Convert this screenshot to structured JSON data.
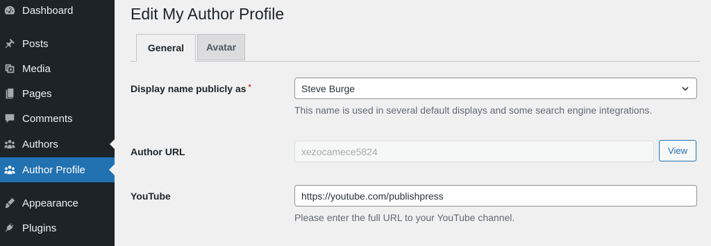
{
  "sidebar": {
    "items": [
      {
        "label": "Dashboard",
        "icon": "dashboard-icon"
      },
      {
        "label": "Posts",
        "icon": "pin-icon"
      },
      {
        "label": "Media",
        "icon": "media-icon"
      },
      {
        "label": "Pages",
        "icon": "pages-icon"
      },
      {
        "label": "Comments",
        "icon": "comment-icon"
      },
      {
        "label": "Authors",
        "icon": "authors-icon"
      },
      {
        "label": "Author Profile",
        "icon": "authors-icon",
        "active": true
      },
      {
        "label": "Appearance",
        "icon": "brush-icon"
      },
      {
        "label": "Plugins",
        "icon": "plugin-icon"
      }
    ],
    "accent_color": "#2271b1",
    "background_color": "#1d2327"
  },
  "page": {
    "title": "Edit My Author Profile"
  },
  "tabs": [
    {
      "label": "General",
      "active": true
    },
    {
      "label": "Avatar",
      "active": false
    }
  ],
  "fields": {
    "display_name": {
      "label": "Display name publicly as",
      "required_mark": "*",
      "value": "Steve Burge",
      "help": "This name is used in several default displays and some search engine integrations."
    },
    "author_url": {
      "label": "Author URL",
      "value": "xezocamece5824",
      "button_label": "View"
    },
    "youtube": {
      "label": "YouTube",
      "value": "https://youtube.com/publishpress",
      "help": "Please enter the full URL to your YouTube channel."
    }
  }
}
